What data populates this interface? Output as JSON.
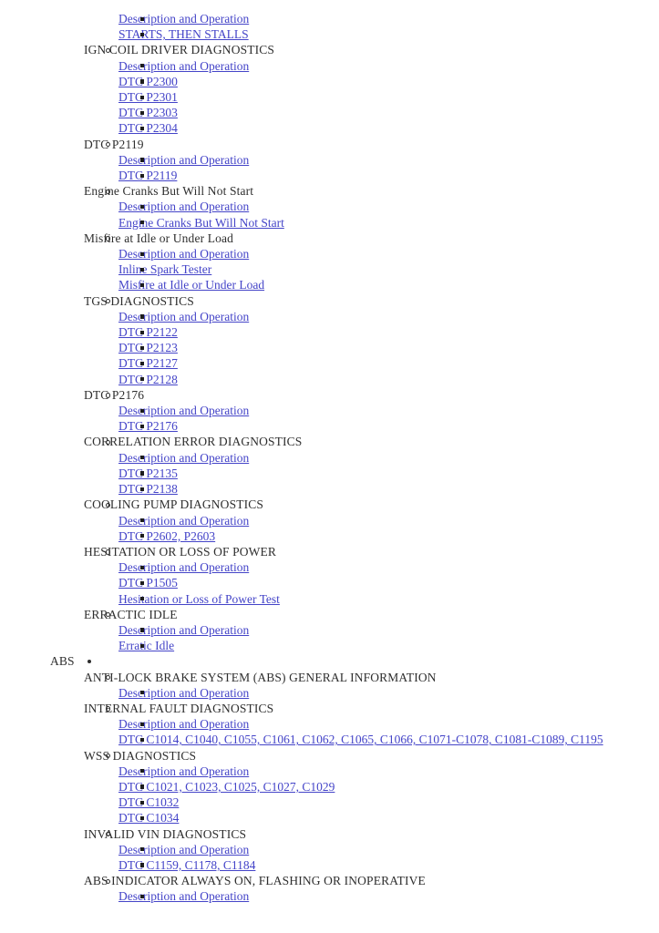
{
  "document": {
    "type": "service-manual-table-of-contents",
    "link_color": "#4444c8",
    "text_color": "#2e2e2e",
    "background_color": "#ffffff",
    "common_labels": {
      "description_and_operation": "Description and Operation"
    }
  },
  "sections": [
    {
      "level": 2,
      "heading": null,
      "is_link": false,
      "partial_top": true,
      "links": [
        "Description and Operation",
        "STARTS, THEN STALLS"
      ]
    },
    {
      "level": 2,
      "heading": "IGN COIL DRIVER DIAGNOSTICS",
      "is_link": false,
      "links": [
        "Description and Operation",
        "DTC P2300",
        "DTC P2301",
        "DTC P2303",
        "DTC P2304"
      ]
    },
    {
      "level": 2,
      "heading": "DTC P2119",
      "is_link": false,
      "links": [
        "Description and Operation",
        "DTC P2119"
      ]
    },
    {
      "level": 2,
      "heading": "Engine Cranks But Will Not Start",
      "is_link": false,
      "links": [
        "Description and Operation",
        "Engine Cranks But Will Not Start"
      ]
    },
    {
      "level": 2,
      "heading": "Misfire at Idle or Under Load",
      "is_link": false,
      "links": [
        "Description and Operation",
        "Inline Spark Tester",
        "Misfire at Idle or Under Load"
      ]
    },
    {
      "level": 2,
      "heading": "TGS DIAGNOSTICS",
      "is_link": false,
      "links": [
        "Description and Operation",
        "DTC P2122",
        "DTC P2123",
        "DTC P2127",
        "DTC P2128"
      ]
    },
    {
      "level": 2,
      "heading": "DTC P2176",
      "is_link": false,
      "links": [
        "Description and Operation",
        "DTC P2176"
      ]
    },
    {
      "level": 2,
      "heading": "CORRELATION ERROR DIAGNOSTICS",
      "is_link": false,
      "links": [
        "Description and Operation",
        "DTC P2135",
        "DTC P2138"
      ]
    },
    {
      "level": 2,
      "heading": "COOLING PUMP DIAGNOSTICS",
      "is_link": false,
      "links": [
        "Description and Operation",
        "DTC P2602, P2603"
      ]
    },
    {
      "level": 2,
      "heading": "HESITATION OR LOSS OF POWER",
      "is_link": false,
      "links": [
        "Description and Operation",
        "DTC P1505",
        "Hesitation or Loss of Power Test"
      ]
    },
    {
      "level": 2,
      "heading": "ERRACTIC IDLE",
      "is_link": false,
      "links": [
        "Description and Operation",
        "Erratic Idle"
      ]
    }
  ],
  "abs_group": {
    "heading": "ABS",
    "subsections": [
      {
        "heading": "ANTI-LOCK BRAKE SYSTEM (ABS) GENERAL INFORMATION",
        "links": [
          "Description and Operation"
        ]
      },
      {
        "heading": "INTERNAL FAULT DIAGNOSTICS",
        "links": [
          "Description and Operation",
          "DTC C1014, C1040, C1055, C1061, C1062, C1065, C1066, C1071-C1078, C1081-C1089, C1195"
        ]
      },
      {
        "heading": "WSS DIAGNOSTICS",
        "links": [
          "Description and Operation",
          "DTC C1021, C1023, C1025, C1027, C1029",
          "DTC C1032",
          "DTC C1034"
        ]
      },
      {
        "heading": "INVALID VIN DIAGNOSTICS",
        "links": [
          "Description and Operation",
          "DTC C1159, C1178, C1184"
        ]
      },
      {
        "heading": "ABS INDICATOR ALWAYS ON, FLASHING OR INOPERATIVE",
        "links": [
          "Description and Operation"
        ]
      }
    ]
  }
}
